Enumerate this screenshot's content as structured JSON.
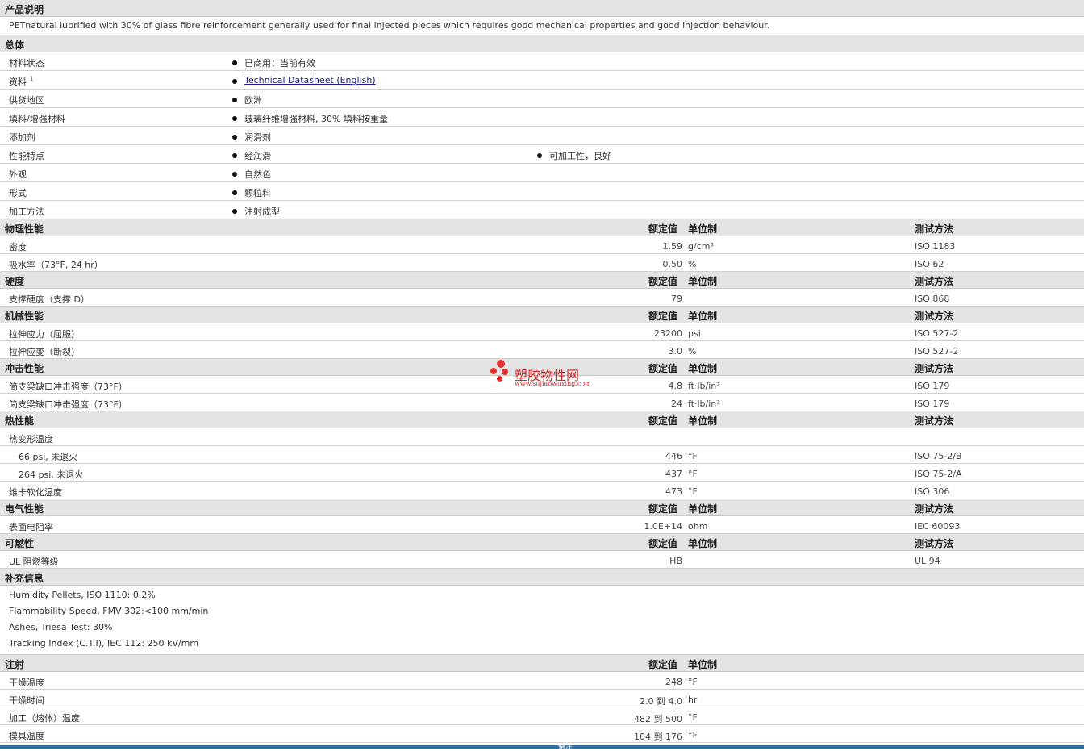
{
  "product_desc": {
    "title": "产品说明",
    "text": "PETnatural lubrified with 30% of glass fibre reinforcement generally used for final injected pieces which requires good mechanical properties and good injection behaviour."
  },
  "general": {
    "title": "总体",
    "rows": [
      {
        "label": "材料状态",
        "values": [
          "已商用：当前有效"
        ]
      },
      {
        "label": "资料",
        "sup": "1",
        "link": "Technical Datasheet (English)"
      },
      {
        "label": "供货地区",
        "values": [
          "欧洲"
        ]
      },
      {
        "label": "填料/增强材料",
        "values": [
          "玻璃纤维增强材料, 30% 填料按重量"
        ]
      },
      {
        "label": "添加剂",
        "values": [
          "润滑剂"
        ]
      },
      {
        "label": "性能特点",
        "values": [
          "经润滑",
          "可加工性，良好"
        ]
      },
      {
        "label": "外观",
        "values": [
          "自然色"
        ]
      },
      {
        "label": "形式",
        "values": [
          "颗粒料"
        ]
      },
      {
        "label": "加工方法",
        "values": [
          "注射成型"
        ]
      }
    ]
  },
  "cols": {
    "value": "额定值",
    "unit": "单位制",
    "test": "测试方法"
  },
  "physical": {
    "title": "物理性能",
    "rows": [
      {
        "label": "密度",
        "value": "1.59",
        "unit": "g/cm³",
        "test": "ISO 1183"
      },
      {
        "label": "吸水率（73°F, 24 hr）",
        "value": "0.50",
        "unit": "%",
        "test": "ISO 62"
      }
    ]
  },
  "hardness": {
    "title": "硬度",
    "rows": [
      {
        "label": "支撑硬度（支撑 D）",
        "value": "79",
        "unit": "",
        "test": "ISO 868"
      }
    ]
  },
  "mechanical": {
    "title": "机械性能",
    "rows": [
      {
        "label": "拉伸应力（屈服）",
        "value": "23200",
        "unit": "psi",
        "test": "ISO 527-2"
      },
      {
        "label": "拉伸应变（断裂）",
        "value": "3.0",
        "unit": "%",
        "test": "ISO 527-2"
      }
    ]
  },
  "impact": {
    "title": "冲击性能",
    "rows": [
      {
        "label": "简支梁缺口冲击强度（73°F）",
        "value": "4.8",
        "unit": "ft·lb/in²",
        "test": "ISO 179"
      },
      {
        "label": "简支梁缺口冲击强度（73°F）",
        "value": "24",
        "unit": "ft·lb/in²",
        "test": "ISO 179"
      }
    ]
  },
  "thermal": {
    "title": "热性能",
    "rows": [
      {
        "label": "热变形温度",
        "value": "",
        "unit": "",
        "test": ""
      },
      {
        "label": "66 psi, 未退火",
        "value": "446",
        "unit": "°F",
        "test": "ISO 75-2/B"
      },
      {
        "label": "264 psi, 未退火",
        "value": "437",
        "unit": "°F",
        "test": "ISO 75-2/A"
      },
      {
        "label": "维卡软化温度",
        "value": "473",
        "unit": "°F",
        "test": "ISO 306"
      }
    ]
  },
  "electrical": {
    "title": "电气性能",
    "rows": [
      {
        "label": "表面电阻率",
        "value": "1.0E+14",
        "unit": "ohm",
        "test": "IEC 60093"
      }
    ]
  },
  "flammability": {
    "title": "可燃性",
    "rows": [
      {
        "label": "UL 阻燃等级",
        "value": "HB",
        "unit": "",
        "test": "UL 94"
      }
    ]
  },
  "supplemental": {
    "title": "补充信息",
    "lines": [
      "Humidity Pellets, ISO 1110: 0.2%",
      "Flammability Speed, FMV 302:<100 mm/min",
      "Ashes, Triesa Test: 30%",
      "Tracking Index (C.T.I), IEC 112: 250 kV/mm"
    ]
  },
  "injection": {
    "title": "注射",
    "rows": [
      {
        "label": "干燥温度",
        "value": "248",
        "unit": "°F"
      },
      {
        "label": "干燥时间",
        "value": "2.0 到  4.0",
        "unit": "hr"
      },
      {
        "label": "加工（熔体）温度",
        "value": "482 到  500",
        "unit": "°F"
      },
      {
        "label": "模具温度",
        "value": "104 到  176",
        "unit": "°F"
      }
    ]
  },
  "watermark": {
    "cn": "塑胶物性网",
    "en": "www.sujiaowuxing.com"
  },
  "footer": {
    "text": "备注"
  },
  "colors": {
    "header_bg": "#e4e4e4",
    "link": "#1a1a9a",
    "watermark": "#d02828",
    "footer": "#2f6fa8"
  }
}
